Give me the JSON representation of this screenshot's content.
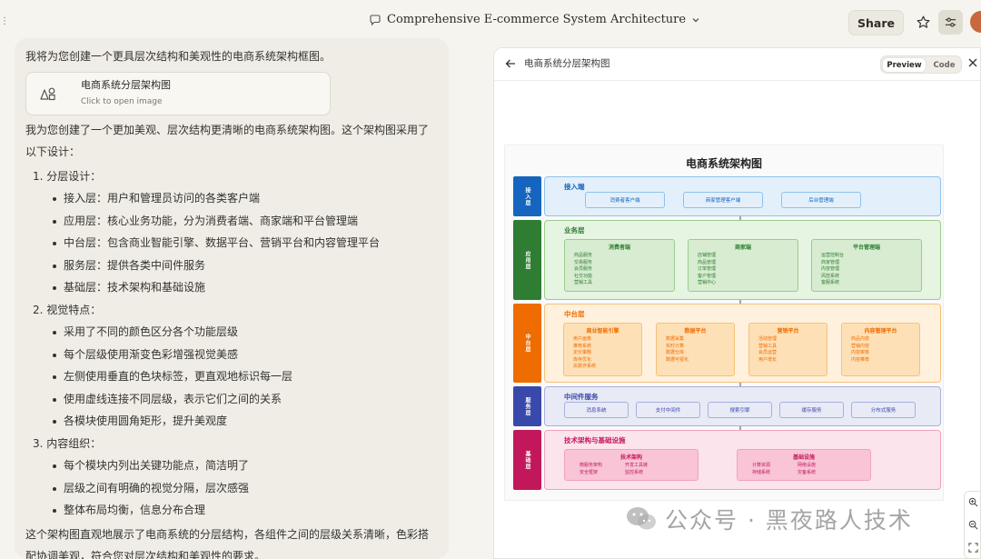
{
  "header": {
    "conversation_title": "Comprehensive E-commerce System Architecture",
    "share_label": "Share"
  },
  "chat": {
    "intro": "我将为您创建一个更具层次结构和美观性的电商系统架构框图。",
    "artifact_card": {
      "title": "电商系统分层架构图",
      "subtitle": "Click to open image"
    },
    "summary": "我为您创建了一个更加美观、层次结构更清晰的电商系统架构图。这个架构图采用了以下设计：",
    "sections": [
      {
        "title": "1. 分层设计：",
        "items": [
          "接入层：用户和管理员访问的各类客户端",
          "应用层：核心业务功能，分为消费者端、商家端和平台管理端",
          "中台层：包含商业智能引擎、数据平台、营销平台和内容管理平台",
          "服务层：提供各类中间件服务",
          "基础层：技术架构和基础设施"
        ]
      },
      {
        "title": "2. 视觉特点：",
        "items": [
          "采用了不同的颜色区分各个功能层级",
          "每个层级使用渐变色彩增强视觉美感",
          "左侧使用垂直的色块标签，更直观地标识每一层",
          "使用虚线连接不同层级，表示它们之间的关系",
          "各模块使用圆角矩形，提升美观度"
        ]
      },
      {
        "title": "3. 内容组织：",
        "items": [
          "每个模块内列出关键功能点，简洁明了",
          "层级之间有明确的视觉分隔，层次感强",
          "整体布局均衡，信息分布合理"
        ]
      }
    ],
    "conclusion": "这个架构图直观地展示了电商系统的分层结构，各组件之间的层级关系清晰，色彩搭配协调美观，符合您对层次结构和美观性的要求。"
  },
  "panel": {
    "title": "电商系统分层架构图",
    "preview_label": "Preview",
    "code_label": "Code"
  },
  "diagram": {
    "title": "电商系统架构图",
    "layers": [
      {
        "tag": "接入层",
        "name": "接入端",
        "color": "#1565c0",
        "bg": "#e3f0fb",
        "border": "#90c2ea",
        "chips": [
          "消费者客户端",
          "商家管理客户端",
          "后台管理端"
        ]
      },
      {
        "tag": "应用层",
        "name": "业务层",
        "color": "#2e7d32",
        "bg": "#e6f4e2",
        "border": "#9ccc8f",
        "cards": [
          {
            "title": "消费者端",
            "items": [
              "商品服务",
              "交易服务",
              "会员服务",
              "社交功能",
              "营销工具"
            ]
          },
          {
            "title": "商家端",
            "items": [
              "店铺管理",
              "商品管理",
              "订单管理",
              "客户管理",
              "营销中心"
            ]
          },
          {
            "title": "平台管理端",
            "items": [
              "运营控制台",
              "商家管理",
              "内容管理",
              "风控系统",
              "客服系统"
            ]
          }
        ]
      },
      {
        "tag": "中台层",
        "name": "中台层",
        "color": "#ef6c00",
        "bg": "#fff1de",
        "border": "#f5c27a",
        "cards": [
          {
            "title": "商业智能引擎",
            "items": [
              "用户画像",
              "推荐系统",
              "定价策略",
              "库存优化",
              "反欺诈系统"
            ]
          },
          {
            "title": "数据平台",
            "items": [
              "数据采集",
              "实时计算",
              "数据仓库",
              "数据可视化"
            ]
          },
          {
            "title": "营销平台",
            "items": [
              "活动管理",
              "营销工具",
              "会员运营",
              "用户增长"
            ]
          },
          {
            "title": "内容管理平台",
            "items": [
              "商品内容",
              "营销内容",
              "内容审核",
              "内容推荐"
            ]
          }
        ]
      },
      {
        "tag": "服务层",
        "name": "中间件服务",
        "color": "#3949ab",
        "bg": "#e8eaf6",
        "border": "#a8b0de",
        "chips": [
          "消息系统",
          "支付中间件",
          "搜索引擎",
          "缓存服务",
          "分布式服务"
        ]
      },
      {
        "tag": "基础层",
        "name": "技术架构与基础设施",
        "color": "#c2185b",
        "bg": "#fce4ec",
        "border": "#f0a3bd",
        "cards": [
          {
            "title": "技术架构",
            "items": [
              "微服务架构",
              "开发工具链",
              "安全框架",
              "监控系统"
            ]
          },
          {
            "title": "基础设施",
            "items": [
              "计算资源",
              "网络设施",
              "存储系统",
              "灾备系统"
            ]
          }
        ]
      }
    ]
  },
  "watermark": "公众号 · 黑夜路人技术"
}
